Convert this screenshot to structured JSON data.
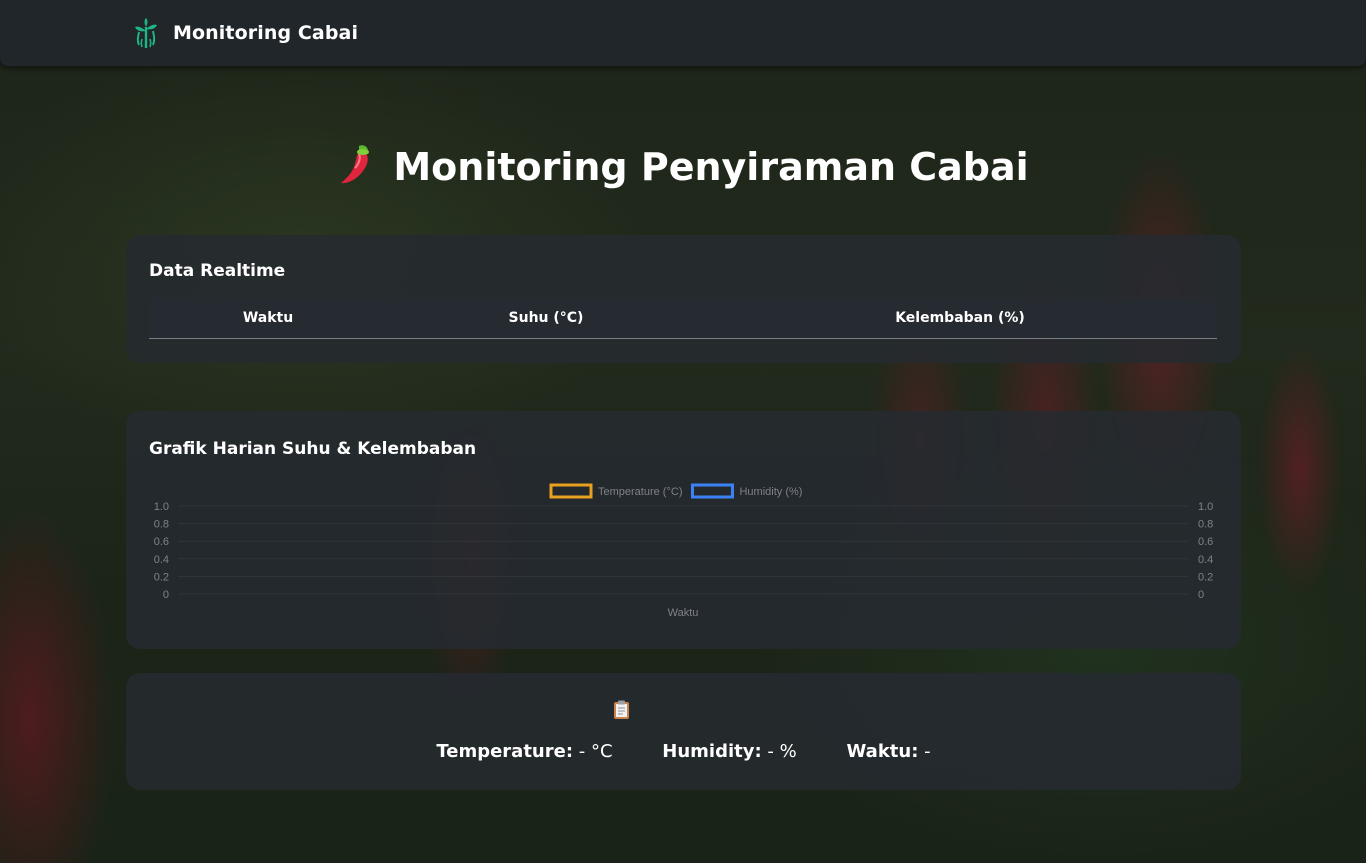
{
  "navbar": {
    "brand": "Monitoring Cabai"
  },
  "page": {
    "title": "Monitoring Penyiraman Cabai"
  },
  "realtime": {
    "title": "Data Realtime",
    "columns": [
      "Waktu",
      "Suhu (°C)",
      "Kelembaban (%)"
    ]
  },
  "chart": {
    "title": "Grafik Harian Suhu & Kelembaban"
  },
  "chart_data": {
    "type": "line",
    "x": [],
    "series": [
      {
        "name": "Temperature (°C)",
        "values": [],
        "color": "#e8a020",
        "axis": "left"
      },
      {
        "name": "Humidity (%)",
        "values": [],
        "color": "#3b82f6",
        "axis": "right"
      }
    ],
    "xlabel": "Waktu",
    "ylabel": "",
    "ylim": [
      0,
      1.0
    ],
    "y_ticks": [
      "1.0",
      "0.8",
      "0.6",
      "0.4",
      "0.2",
      "0"
    ],
    "y2_ticks": [
      "1.0",
      "0.8",
      "0.6",
      "0.4",
      "0.2",
      "0"
    ],
    "legend": "top-center",
    "grid": true
  },
  "info": {
    "temperature_label": "Temperature:",
    "temperature_value": " - °C",
    "humidity_label": "Humidity:",
    "humidity_value": " - %",
    "waktu_label": "Waktu:",
    "waktu_value": " -"
  },
  "icons": {
    "brand": "chili-plant-icon",
    "title": "chili-pepper-icon",
    "info": "clipboard-icon"
  },
  "colors": {
    "brand_green": "#1db584",
    "temperature": "#e8a020",
    "humidity": "#3b82f6",
    "card_bg": "#262a30",
    "navbar_bg": "#21262a"
  }
}
